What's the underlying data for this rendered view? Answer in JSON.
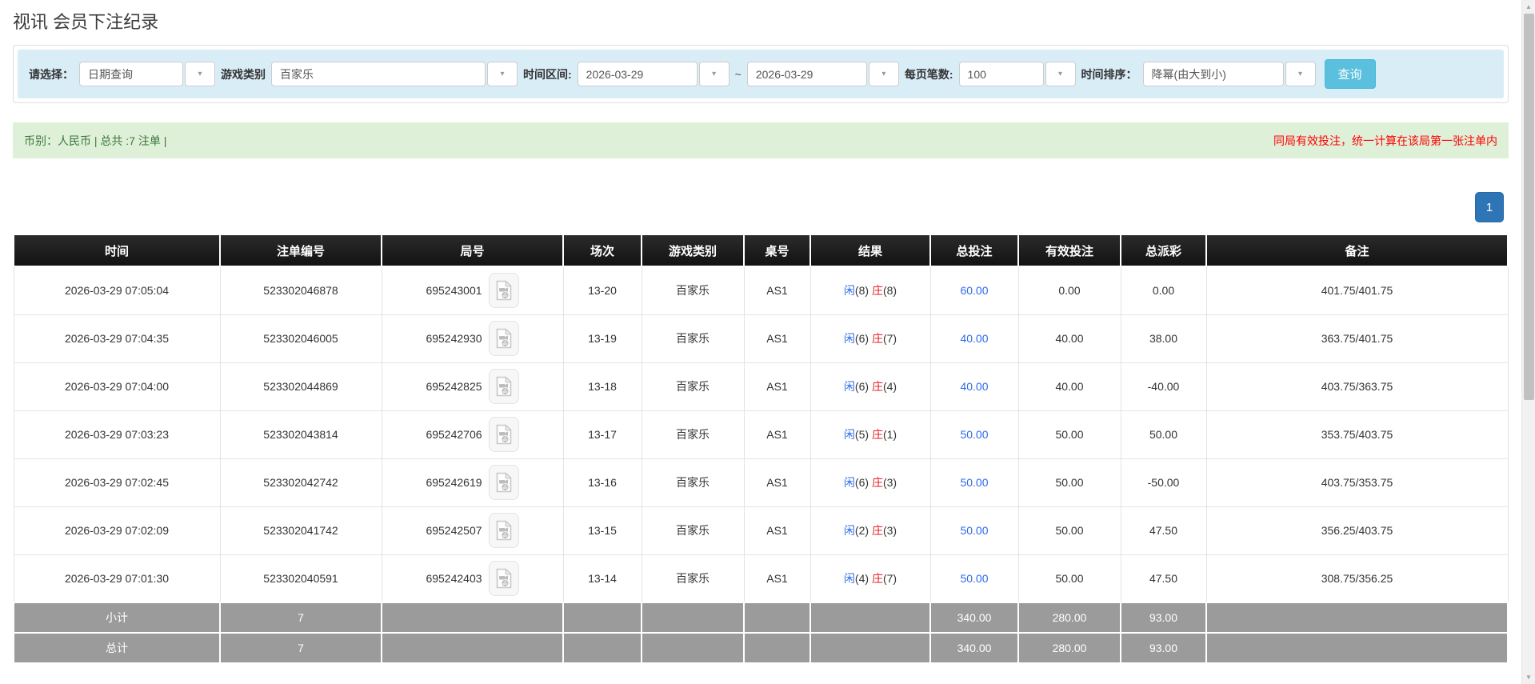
{
  "page": {
    "title": "视讯 会员下注纪录"
  },
  "filters": {
    "select_label": "请选择：",
    "select_value": "日期查询",
    "game_type_label": "游戏类别",
    "game_type_value": "百家乐",
    "time_range_label": "时间区间:",
    "date_from": "2026-03-29",
    "tilde": "~",
    "date_to": "2026-03-29",
    "page_size_label": "每页笔数:",
    "page_size_value": "100",
    "sort_label": "时间排序：",
    "sort_value": "降幂(由大到小)",
    "search_button": "查询"
  },
  "summary_bar": {
    "left": "币别：人民币 | 总共 :7 注单 |",
    "right": "同局有效投注，统一计算在该局第一张注单内"
  },
  "pagination": {
    "current": "1"
  },
  "table": {
    "headers": [
      "时间",
      "注单编号",
      "局号",
      "场次",
      "游戏类别",
      "桌号",
      "结果",
      "总投注",
      "有效投注",
      "总派彩",
      "备注"
    ],
    "rows": [
      {
        "time": "2026-03-29 07:05:04",
        "bet_id": "523302046878",
        "round_id": "695243001",
        "session": "13-20",
        "game": "百家乐",
        "table_no": "AS1",
        "result": {
          "player": "闲(8)",
          "banker": "庄(8)"
        },
        "total_bet": "60.00",
        "valid_bet": "0.00",
        "payout": "0.00",
        "note": "401.75/401.75"
      },
      {
        "time": "2026-03-29 07:04:35",
        "bet_id": "523302046005",
        "round_id": "695242930",
        "session": "13-19",
        "game": "百家乐",
        "table_no": "AS1",
        "result": {
          "player": "闲(6)",
          "banker": "庄(7)"
        },
        "total_bet": "40.00",
        "valid_bet": "40.00",
        "payout": "38.00",
        "note": "363.75/401.75"
      },
      {
        "time": "2026-03-29 07:04:00",
        "bet_id": "523302044869",
        "round_id": "695242825",
        "session": "13-18",
        "game": "百家乐",
        "table_no": "AS1",
        "result": {
          "player": "闲(6)",
          "banker": "庄(4)"
        },
        "total_bet": "40.00",
        "valid_bet": "40.00",
        "payout": "-40.00",
        "note": "403.75/363.75"
      },
      {
        "time": "2026-03-29 07:03:23",
        "bet_id": "523302043814",
        "round_id": "695242706",
        "session": "13-17",
        "game": "百家乐",
        "table_no": "AS1",
        "result": {
          "player": "闲(5)",
          "banker": "庄(1)"
        },
        "total_bet": "50.00",
        "valid_bet": "50.00",
        "payout": "50.00",
        "note": "353.75/403.75"
      },
      {
        "time": "2026-03-29 07:02:45",
        "bet_id": "523302042742",
        "round_id": "695242619",
        "session": "13-16",
        "game": "百家乐",
        "table_no": "AS1",
        "result": {
          "player": "闲(6)",
          "banker": "庄(3)"
        },
        "total_bet": "50.00",
        "valid_bet": "50.00",
        "payout": "-50.00",
        "note": "403.75/353.75"
      },
      {
        "time": "2026-03-29 07:02:09",
        "bet_id": "523302041742",
        "round_id": "695242507",
        "session": "13-15",
        "game": "百家乐",
        "table_no": "AS1",
        "result": {
          "player": "闲(2)",
          "banker": "庄(3)"
        },
        "total_bet": "50.00",
        "valid_bet": "50.00",
        "payout": "47.50",
        "note": "356.25/403.75"
      },
      {
        "time": "2026-03-29 07:01:30",
        "bet_id": "523302040591",
        "round_id": "695242403",
        "session": "13-14",
        "game": "百家乐",
        "table_no": "AS1",
        "result": {
          "player": "闲(4)",
          "banker": "庄(7)"
        },
        "total_bet": "50.00",
        "valid_bet": "50.00",
        "payout": "47.50",
        "note": "308.75/356.25"
      }
    ],
    "summary_rows": [
      {
        "label": "小计",
        "count": "7",
        "total_bet": "340.00",
        "valid_bet": "280.00",
        "payout": "93.00"
      },
      {
        "label": "总计",
        "count": "7",
        "total_bet": "340.00",
        "valid_bet": "280.00",
        "payout": "93.00"
      }
    ]
  },
  "colors": {
    "filter_bar_bg": "#d9edf7",
    "search_button_bg": "#5bc0de",
    "summary_bar_bg": "#dff0d8",
    "summary_text_green": "#3c763d",
    "notice_red": "#ff0000",
    "pagination_active_bg": "#2e75b5",
    "table_header_bg": "#1a1a1a",
    "link_blue": "#2e6be6",
    "player_blue": "#2e6be6",
    "banker_red": "#e62222",
    "negative_red": "#f00c0c",
    "summary_row_bg": "#9b9b9b"
  }
}
